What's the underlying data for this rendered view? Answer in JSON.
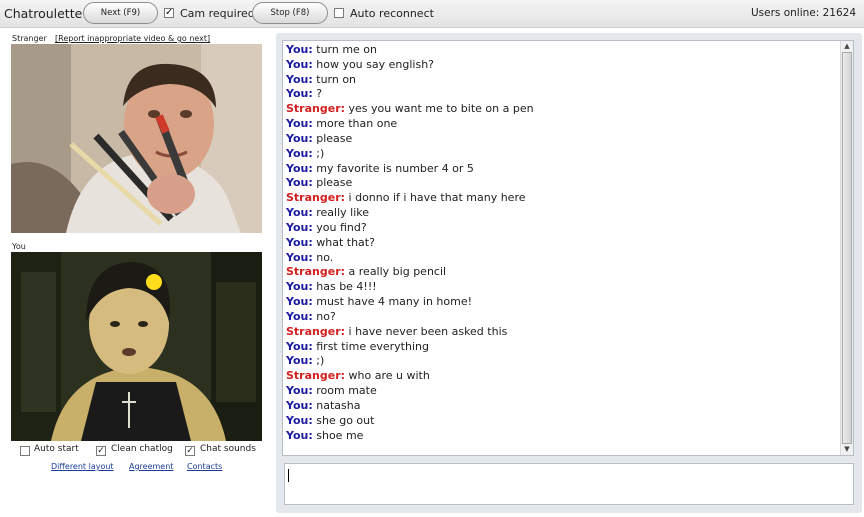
{
  "topbar": {
    "title": "Chatroulette",
    "next_label": "Next (F9)",
    "cam_required_label": "Cam required",
    "cam_required_checked": true,
    "stop_label": "Stop (F8)",
    "auto_reconnect_label": "Auto reconnect",
    "auto_reconnect_checked": false,
    "users_online": "Users online: 21624"
  },
  "left": {
    "stranger_label": "Stranger",
    "report_link": "[Report inappropriate video & go next]",
    "you_label": "You",
    "options": [
      {
        "label": "Auto start",
        "checked": false
      },
      {
        "label": "Clean chatlog",
        "checked": true
      },
      {
        "label": "Chat sounds",
        "checked": true
      }
    ],
    "links": [
      "Different layout",
      "Agreement",
      "Contacts"
    ]
  },
  "chat": {
    "speaker_colors": {
      "You": "#1a1a9e",
      "Stranger": "#d22020"
    },
    "messages": [
      {
        "who": "You:",
        "text": "turn me on"
      },
      {
        "who": "You:",
        "text": "how you say english?"
      },
      {
        "who": "You:",
        "text": "turn on"
      },
      {
        "who": "You:",
        "text": "?"
      },
      {
        "who": "Stranger:",
        "text": "yes you want me to bite on a pen"
      },
      {
        "who": "You:",
        "text": "more than one"
      },
      {
        "who": "You:",
        "text": "please"
      },
      {
        "who": "You:",
        "text": ";)"
      },
      {
        "who": "You:",
        "text": "my favorite is number 4 or 5"
      },
      {
        "who": "You:",
        "text": "please"
      },
      {
        "who": "Stranger:",
        "text": "i donno if i have that many here"
      },
      {
        "who": "You:",
        "text": "really like"
      },
      {
        "who": "You:",
        "text": "you find?"
      },
      {
        "who": "You:",
        "text": "what that?"
      },
      {
        "who": "You:",
        "text": "no."
      },
      {
        "who": "Stranger:",
        "text": "a really big pencil"
      },
      {
        "who": "You:",
        "text": "has be 4!!!"
      },
      {
        "who": "You:",
        "text": "must have 4 many in home!"
      },
      {
        "who": "You:",
        "text": "no?"
      },
      {
        "who": "Stranger:",
        "text": "i have never been asked this"
      },
      {
        "who": "You:",
        "text": "first time everything"
      },
      {
        "who": "You:",
        "text": ";)"
      },
      {
        "who": "Stranger:",
        "text": "who are u with"
      },
      {
        "who": "You:",
        "text": "room mate"
      },
      {
        "who": "You:",
        "text": "natasha"
      },
      {
        "who": "You:",
        "text": "she go out"
      },
      {
        "who": "You:",
        "text": "shoe me"
      }
    ],
    "input_value": ""
  }
}
